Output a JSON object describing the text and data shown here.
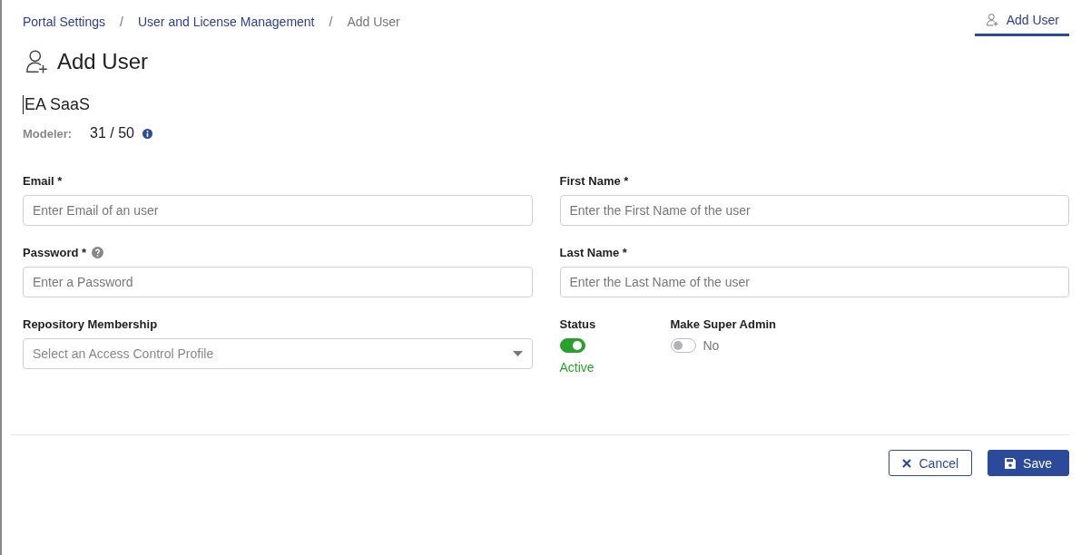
{
  "breadcrumb": [
    {
      "kind": "link",
      "label": "Portal Settings",
      "current": false
    },
    {
      "kind": "separator",
      "label": "/"
    },
    {
      "kind": "link",
      "label": "User and License Management",
      "current": false
    },
    {
      "kind": "separator",
      "label": "/"
    },
    {
      "kind": "link",
      "label": "Add User",
      "current": true
    }
  ],
  "tabs": [
    {
      "label": "Add User",
      "selected": true
    }
  ],
  "title": "Add User",
  "product": "EA SaaS",
  "license": {
    "label": "Modeler:",
    "value": "31 / 50"
  },
  "left_fields": [
    {
      "kind": "input",
      "label": "Email *",
      "help": false,
      "placeholder": "Enter Email of an user"
    },
    {
      "kind": "input",
      "label": "Password *",
      "help": true,
      "placeholder": "Enter a Password"
    },
    {
      "kind": "select",
      "label": "Repository Membership",
      "help": false,
      "placeholder": "Select an Access Control Profile"
    }
  ],
  "right_fields": [
    {
      "kind": "input",
      "label": "First Name *",
      "help": false,
      "placeholder": "Enter the First Name of the user"
    },
    {
      "kind": "input",
      "label": "Last Name *",
      "help": false,
      "placeholder": "Enter the Last Name of the user"
    }
  ],
  "toggles": [
    {
      "label": "Status",
      "on": true,
      "caption": "Active"
    },
    {
      "label": "Make Super Admin",
      "on": false,
      "caption": "No"
    }
  ],
  "buttons": [
    {
      "kind": "secondary",
      "label": "Cancel"
    },
    {
      "kind": "primary",
      "label": "Save"
    }
  ]
}
